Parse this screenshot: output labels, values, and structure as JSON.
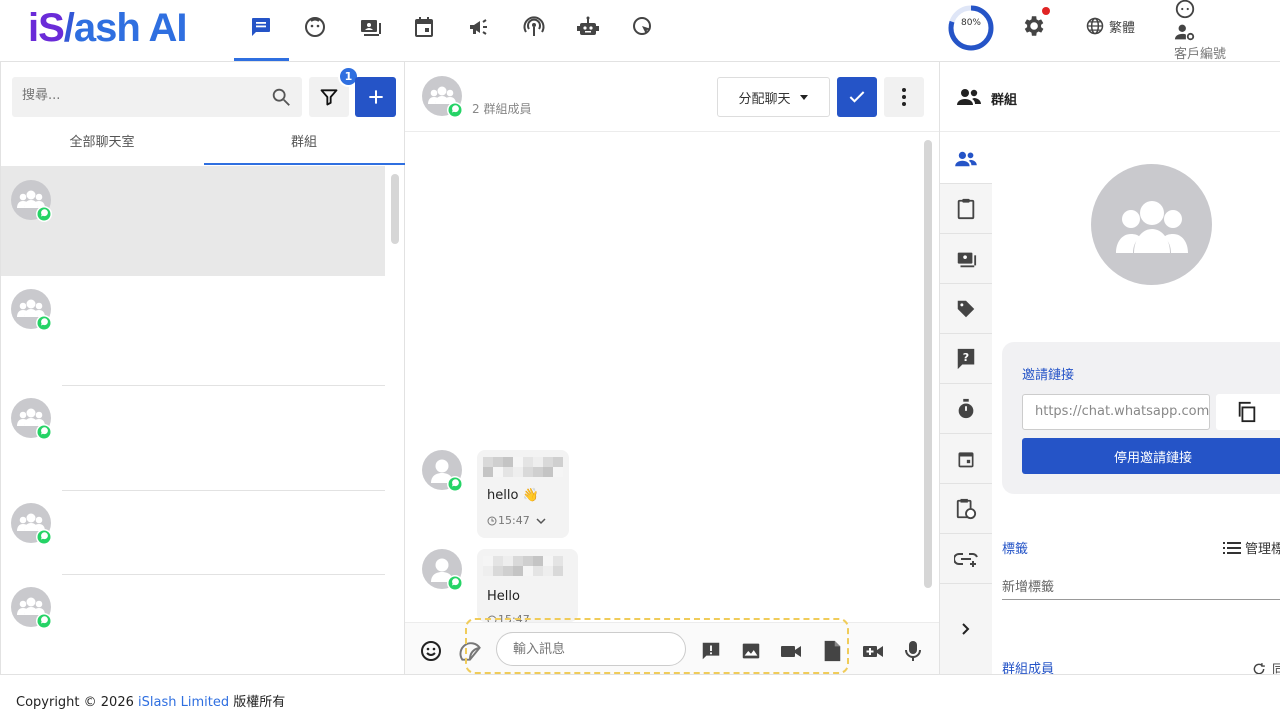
{
  "app": {
    "logo": {
      "part1": "iS",
      "part2": "/",
      "part3": "ash AI"
    },
    "nav_icons": [
      "chat-icon",
      "face-icon",
      "contacts-icon",
      "calendar-icon",
      "broadcast-icon",
      "podcast-icon",
      "robot-icon",
      "cursor-icon"
    ],
    "progress": {
      "percent": 80,
      "label": "80%"
    },
    "language": "繁體",
    "profile_label": "客戶編號"
  },
  "sidebar": {
    "search_placeholder": "搜尋...",
    "filter_badge": "1",
    "tabs": [
      {
        "label": "全部聊天室"
      },
      {
        "label": "群組"
      }
    ],
    "active_tab": 1
  },
  "chat": {
    "header_members": "2 群組成員",
    "assign_label": "分配聊天",
    "messages": [
      {
        "text": "hello 👋",
        "time": "15:47"
      },
      {
        "text": "Hello",
        "time": "15:47"
      }
    ],
    "input_placeholder": "輸入訊息"
  },
  "details": {
    "title": "群組",
    "invite_label": "邀請鏈接",
    "invite_link": "https://chat.whatsapp.com",
    "disable_invite": "停用邀請鏈接",
    "tags_label": "標籤",
    "manage_tags": "管理標",
    "add_tag": "新增標籤",
    "members_label": "群組成員",
    "refresh_label": "同"
  },
  "footer": {
    "prefix": "Copyright © 2026 ",
    "brand": "iSlash Limited",
    "suffix": " 版權所有"
  },
  "colors": {
    "primary": "#2554c7",
    "accent": "#2f6fe0",
    "whatsapp": "#25d366"
  }
}
